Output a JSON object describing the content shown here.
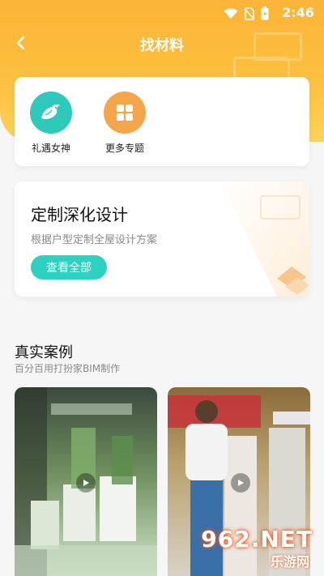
{
  "status_bar": {
    "time": "2:46"
  },
  "nav": {
    "title": "找材料"
  },
  "quick": {
    "items": [
      {
        "label": "礼遇女神"
      },
      {
        "label": "更多专题"
      }
    ]
  },
  "design": {
    "title": "定制深化设计",
    "subtitle": "根据户型定制全屋设计方案",
    "button": "查看全部"
  },
  "cases": {
    "title": "真实案例",
    "subtitle": "百分百用打扮家BIM制作"
  },
  "watermark": {
    "text": "962.NET",
    "sub": "乐游网"
  },
  "colors": {
    "header": "#fcb437",
    "accent": "#2ed0c1",
    "orange_icon": "#f5a64a"
  }
}
